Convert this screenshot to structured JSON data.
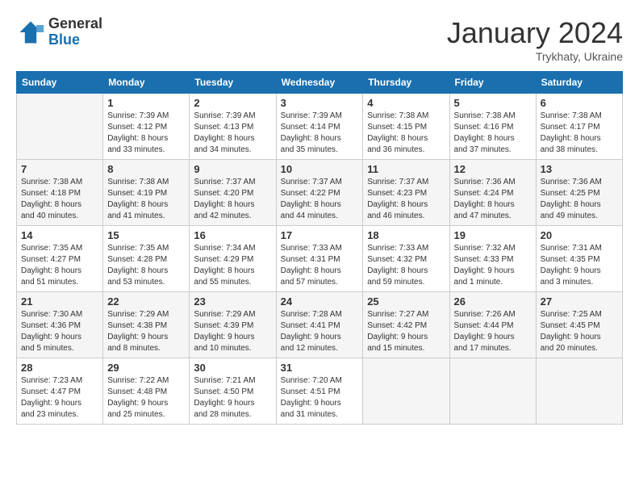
{
  "header": {
    "logo_general": "General",
    "logo_blue": "Blue",
    "month_title": "January 2024",
    "location": "Trykhaty, Ukraine"
  },
  "days_of_week": [
    "Sunday",
    "Monday",
    "Tuesday",
    "Wednesday",
    "Thursday",
    "Friday",
    "Saturday"
  ],
  "weeks": [
    [
      {
        "day": "",
        "info": ""
      },
      {
        "day": "1",
        "info": "Sunrise: 7:39 AM\nSunset: 4:12 PM\nDaylight: 8 hours\nand 33 minutes."
      },
      {
        "day": "2",
        "info": "Sunrise: 7:39 AM\nSunset: 4:13 PM\nDaylight: 8 hours\nand 34 minutes."
      },
      {
        "day": "3",
        "info": "Sunrise: 7:39 AM\nSunset: 4:14 PM\nDaylight: 8 hours\nand 35 minutes."
      },
      {
        "day": "4",
        "info": "Sunrise: 7:38 AM\nSunset: 4:15 PM\nDaylight: 8 hours\nand 36 minutes."
      },
      {
        "day": "5",
        "info": "Sunrise: 7:38 AM\nSunset: 4:16 PM\nDaylight: 8 hours\nand 37 minutes."
      },
      {
        "day": "6",
        "info": "Sunrise: 7:38 AM\nSunset: 4:17 PM\nDaylight: 8 hours\nand 38 minutes."
      }
    ],
    [
      {
        "day": "7",
        "info": "Sunrise: 7:38 AM\nSunset: 4:18 PM\nDaylight: 8 hours\nand 40 minutes."
      },
      {
        "day": "8",
        "info": "Sunrise: 7:38 AM\nSunset: 4:19 PM\nDaylight: 8 hours\nand 41 minutes."
      },
      {
        "day": "9",
        "info": "Sunrise: 7:37 AM\nSunset: 4:20 PM\nDaylight: 8 hours\nand 42 minutes."
      },
      {
        "day": "10",
        "info": "Sunrise: 7:37 AM\nSunset: 4:22 PM\nDaylight: 8 hours\nand 44 minutes."
      },
      {
        "day": "11",
        "info": "Sunrise: 7:37 AM\nSunset: 4:23 PM\nDaylight: 8 hours\nand 46 minutes."
      },
      {
        "day": "12",
        "info": "Sunrise: 7:36 AM\nSunset: 4:24 PM\nDaylight: 8 hours\nand 47 minutes."
      },
      {
        "day": "13",
        "info": "Sunrise: 7:36 AM\nSunset: 4:25 PM\nDaylight: 8 hours\nand 49 minutes."
      }
    ],
    [
      {
        "day": "14",
        "info": "Sunrise: 7:35 AM\nSunset: 4:27 PM\nDaylight: 8 hours\nand 51 minutes."
      },
      {
        "day": "15",
        "info": "Sunrise: 7:35 AM\nSunset: 4:28 PM\nDaylight: 8 hours\nand 53 minutes."
      },
      {
        "day": "16",
        "info": "Sunrise: 7:34 AM\nSunset: 4:29 PM\nDaylight: 8 hours\nand 55 minutes."
      },
      {
        "day": "17",
        "info": "Sunrise: 7:33 AM\nSunset: 4:31 PM\nDaylight: 8 hours\nand 57 minutes."
      },
      {
        "day": "18",
        "info": "Sunrise: 7:33 AM\nSunset: 4:32 PM\nDaylight: 8 hours\nand 59 minutes."
      },
      {
        "day": "19",
        "info": "Sunrise: 7:32 AM\nSunset: 4:33 PM\nDaylight: 9 hours\nand 1 minute."
      },
      {
        "day": "20",
        "info": "Sunrise: 7:31 AM\nSunset: 4:35 PM\nDaylight: 9 hours\nand 3 minutes."
      }
    ],
    [
      {
        "day": "21",
        "info": "Sunrise: 7:30 AM\nSunset: 4:36 PM\nDaylight: 9 hours\nand 5 minutes."
      },
      {
        "day": "22",
        "info": "Sunrise: 7:29 AM\nSunset: 4:38 PM\nDaylight: 9 hours\nand 8 minutes."
      },
      {
        "day": "23",
        "info": "Sunrise: 7:29 AM\nSunset: 4:39 PM\nDaylight: 9 hours\nand 10 minutes."
      },
      {
        "day": "24",
        "info": "Sunrise: 7:28 AM\nSunset: 4:41 PM\nDaylight: 9 hours\nand 12 minutes."
      },
      {
        "day": "25",
        "info": "Sunrise: 7:27 AM\nSunset: 4:42 PM\nDaylight: 9 hours\nand 15 minutes."
      },
      {
        "day": "26",
        "info": "Sunrise: 7:26 AM\nSunset: 4:44 PM\nDaylight: 9 hours\nand 17 minutes."
      },
      {
        "day": "27",
        "info": "Sunrise: 7:25 AM\nSunset: 4:45 PM\nDaylight: 9 hours\nand 20 minutes."
      }
    ],
    [
      {
        "day": "28",
        "info": "Sunrise: 7:23 AM\nSunset: 4:47 PM\nDaylight: 9 hours\nand 23 minutes."
      },
      {
        "day": "29",
        "info": "Sunrise: 7:22 AM\nSunset: 4:48 PM\nDaylight: 9 hours\nand 25 minutes."
      },
      {
        "day": "30",
        "info": "Sunrise: 7:21 AM\nSunset: 4:50 PM\nDaylight: 9 hours\nand 28 minutes."
      },
      {
        "day": "31",
        "info": "Sunrise: 7:20 AM\nSunset: 4:51 PM\nDaylight: 9 hours\nand 31 minutes."
      },
      {
        "day": "",
        "info": ""
      },
      {
        "day": "",
        "info": ""
      },
      {
        "day": "",
        "info": ""
      }
    ]
  ]
}
